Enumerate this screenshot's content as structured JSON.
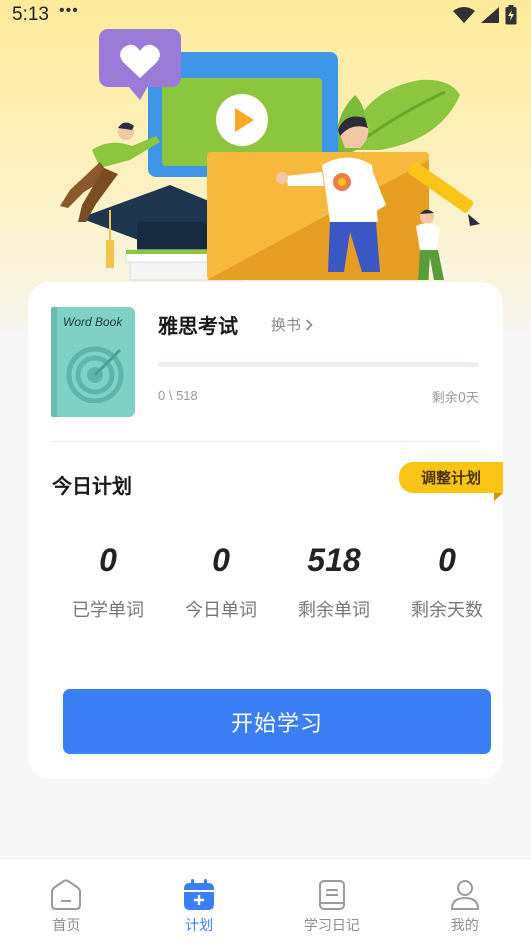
{
  "status_bar": {
    "time": "5:13",
    "dots": "•••"
  },
  "book": {
    "cover_title": "Word Book",
    "title": "雅思考试",
    "change_label": "换书",
    "progress_fraction": 0,
    "progress_text": "0 \\ 518",
    "days_left": "剩余0天"
  },
  "plan": {
    "title": "今日计划",
    "adjust_label": "调整计划",
    "stats": [
      {
        "value": "0",
        "label": "已学单词"
      },
      {
        "value": "0",
        "label": "今日单词"
      },
      {
        "value": "518",
        "label": "剩余单词"
      },
      {
        "value": "0",
        "label": "剩余天数"
      }
    ],
    "start_label": "开始学习"
  },
  "nav": {
    "items": [
      {
        "label": "首页",
        "icon": "home-icon",
        "active": false
      },
      {
        "label": "计划",
        "icon": "calendar-icon",
        "active": true
      },
      {
        "label": "学习日记",
        "icon": "diary-icon",
        "active": false
      },
      {
        "label": "我的",
        "icon": "user-icon",
        "active": false
      }
    ]
  },
  "colors": {
    "accent": "#3a7ff6",
    "adjust_badge": "#f9c416",
    "hero_top": "#fdeb9a"
  }
}
